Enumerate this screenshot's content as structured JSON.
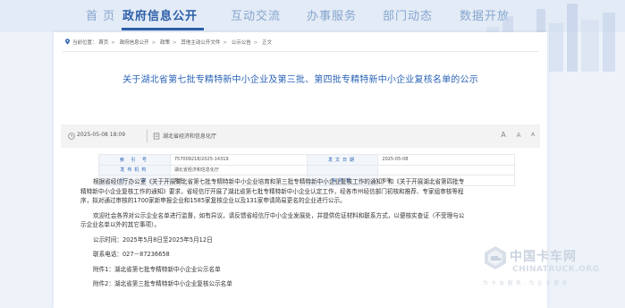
{
  "nav": {
    "items": [
      {
        "label": "首 页",
        "active": false
      },
      {
        "label": "政府信息公开",
        "active": true
      },
      {
        "label": "互动交流",
        "active": false
      },
      {
        "label": "办事服务",
        "active": false
      },
      {
        "label": "部门动态",
        "active": false
      },
      {
        "label": "数据开放",
        "active": false
      }
    ]
  },
  "breadcrumb": {
    "current_label": "当前位置：",
    "items": [
      "首页",
      "政府信息公开",
      "政策",
      "其他主动公开文件",
      "公示公告",
      "正文"
    ]
  },
  "article": {
    "title": "关于湖北省第七批专精特新中小企业及第三批、第四批专精特新中小企业复核名单的公示",
    "date": "2025-05-08 18:09",
    "source": "湖北省经济和信息化厅",
    "font_large": "A",
    "font_small": "A",
    "font_print": "A"
  },
  "info_table": {
    "rows": [
      {
        "l1": "索 引 号",
        "v1": "757009218/2025-14319",
        "l2": "发文日期",
        "v2": "2025-05-08"
      },
      {
        "l1": "发布机构",
        "v1": "湖北省经济和信息化厅",
        "l2": "",
        "v2": ""
      },
      {
        "l1": "分　　类",
        "v1": "其他",
        "l2": "有效性",
        "v2": "有效"
      }
    ]
  },
  "body": {
    "p1": "根据省经信厅办公室《关于开展湖北省第七批专精特新中小企业培育和第三批专精特新中小企业复核工作的通知》和《关于开展湖北省第四批专精特新中小企业复核工作的通知》要求，省经信厅开展了湖北省第七批专精特新中小企业认定工作，经各市州经信部门初核和推荐、专家组审核等程序，拟对通过审核的1700家新申报企业和1585家复核企业以及131家申请简易更名的企业进行公示。",
    "p2": "欢迎社会各界对公示企业名单进行监督，如有异议，请反馈省经信厅中小企业发展处，并提供佐证材料和联系方式，以便核实查证（不受理与公示企业名单以外的其它事项）。",
    "period": "公示时间：2025年5月8日至2025年5月12日",
    "phone": "联系电话：027－87236658",
    "attach1": "附件1：湖北省第七批专精特新中小企业公示名单",
    "attach2": "附件2：湖北省第三批专精特新中小企业复核公示名单"
  },
  "watermark": {
    "cn": "中国卡车网",
    "en": "CHINATRUCK.ORG",
    "sub": "为 卡 友 服 务 · 为 企 业 服 务"
  },
  "colors": {
    "accent": "#2a63b5",
    "nav_bg": "#e3ebf6",
    "page_bg": "#eef3fa"
  }
}
